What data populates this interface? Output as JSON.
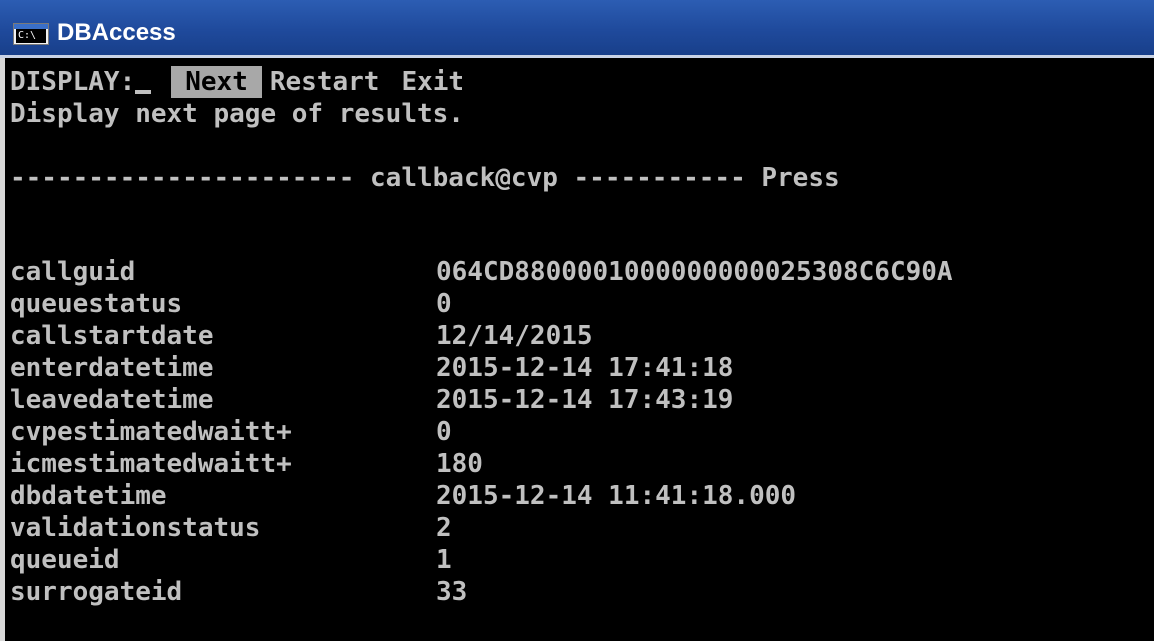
{
  "window": {
    "title": "DBAccess",
    "icon_label": "C:\\"
  },
  "menu": {
    "prompt": "DISPLAY:",
    "items": [
      "Next",
      "Restart",
      "Exit"
    ],
    "selected_index": 0,
    "help": "Display next page of results."
  },
  "header": {
    "dashes_left": "----------------------",
    "table": "callback@cvp",
    "dashes_right": "-----------",
    "hint": "Press"
  },
  "record": [
    {
      "field": "callguid",
      "value": "064CD8800001000000000025308C6C90A"
    },
    {
      "field": "queuestatus",
      "value": "0"
    },
    {
      "field": "callstartdate",
      "value": "12/14/2015"
    },
    {
      "field": "enterdatetime",
      "value": "2015-12-14 17:41:18"
    },
    {
      "field": "leavedatetime",
      "value": "2015-12-14 17:43:19"
    },
    {
      "field": "cvpestimatedwaitt+",
      "value": "0"
    },
    {
      "field": "icmestimatedwaitt+",
      "value": "180"
    },
    {
      "field": "dbdatetime",
      "value": "2015-12-14 11:41:18.000"
    },
    {
      "field": "validationstatus",
      "value": "2"
    },
    {
      "field": "queueid",
      "value": "1"
    },
    {
      "field": "surrogateid",
      "value": "33"
    }
  ]
}
